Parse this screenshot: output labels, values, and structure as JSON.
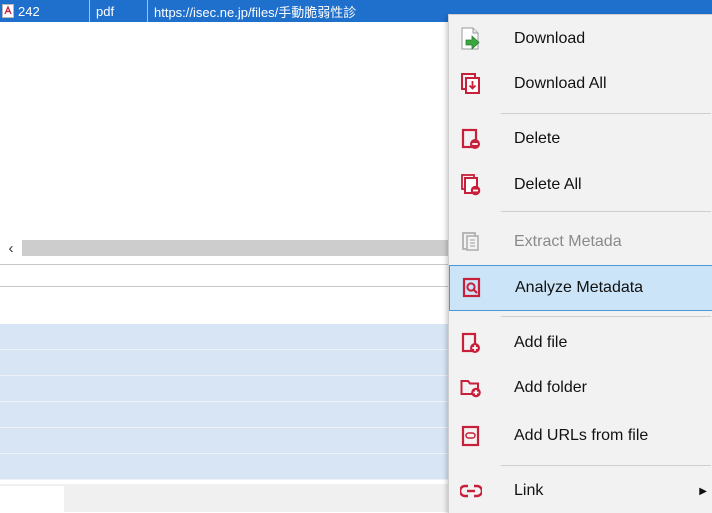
{
  "table": {
    "selected_row": {
      "id": "242",
      "type": "pdf",
      "url": "https://isec.ne.jp/files/手動脆弱性診"
    }
  },
  "menu": {
    "items": [
      {
        "label": "Download",
        "icon": "download-icon"
      },
      {
        "label": "Download All",
        "icon": "download-all-icon"
      },
      {
        "label": "Delete",
        "icon": "delete-icon"
      },
      {
        "label": "Delete All",
        "icon": "delete-all-icon"
      },
      {
        "label": "Extract Metada",
        "icon": "extract-metadata-icon",
        "disabled": true
      },
      {
        "label": "Analyze Metadata",
        "icon": "analyze-metadata-icon",
        "highlighted": true
      },
      {
        "label": "Add file",
        "icon": "add-file-icon"
      },
      {
        "label": "Add folder",
        "icon": "add-folder-icon"
      },
      {
        "label": "Add URLs from file",
        "icon": "add-urls-icon"
      },
      {
        "label": "Link",
        "icon": "link-icon",
        "submenu": true
      }
    ]
  },
  "colors": {
    "selection": "#1f6fcc",
    "icon_red": "#c8203a",
    "icon_green": "#3aa640",
    "highlight_bg": "#cce4f7",
    "highlight_border": "#4a98d8",
    "list_row": "#d7e5f4"
  }
}
